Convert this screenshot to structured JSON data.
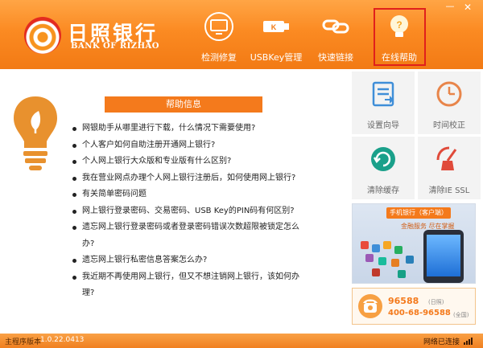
{
  "brand": {
    "name_cn": "日照银行",
    "name_en": "BANK OF RIZHAO"
  },
  "window": {
    "minimize": "—",
    "close": "✕"
  },
  "nav": [
    {
      "label": "检测修复",
      "icon": "monitor-icon"
    },
    {
      "label": "USBKey管理",
      "icon": "usbkey-icon"
    },
    {
      "label": "快速链接",
      "icon": "link-icon"
    },
    {
      "label": "在线帮助",
      "icon": "lightbulb-icon",
      "active": true
    }
  ],
  "help": {
    "title": "帮助信息",
    "items": [
      "网银助手从哪里进行下载，什么情况下需要使用?",
      "个人客户如何自助注册开通网上银行?",
      "个人网上银行大众版和专业版有什么区别?",
      "我在营业网点办理个人网上银行注册后，如何使用网上银行?",
      "有关简单密码问题",
      "网上银行登录密码、交易密码、USB Key的PIN码有何区别?",
      "遗忘网上银行登录密码或者登录密码错误次数超限被锁定怎么办?",
      "遗忘网上银行私密信息答案怎么办?",
      "我近期不再使用网上银行，但又不想注销网上银行，该如何办理?"
    ]
  },
  "tools": [
    {
      "label": "设置向导",
      "icon": "setup-wizard-icon"
    },
    {
      "label": "时间校正",
      "icon": "clock-icon"
    },
    {
      "label": "清除缓存",
      "icon": "clear-cache-icon"
    },
    {
      "label": "清除IE SSL",
      "icon": "broom-icon"
    }
  ],
  "ad": {
    "badge": "手机银行（客户端）",
    "subtitle": "金融服务 尽在掌握"
  },
  "hotline": {
    "number1": "96588",
    "note1": "(日照)",
    "number2": "400-68-96588",
    "note2": "(全国)"
  },
  "status": {
    "label": "主程序版本",
    "version": "1.0.22.0413",
    "network": "网络已连接"
  },
  "colors": {
    "accent": "#f47a1c",
    "highlight_border": "#e0201c",
    "tool_teal": "#1aa08a",
    "tool_red": "#e04a3a"
  }
}
